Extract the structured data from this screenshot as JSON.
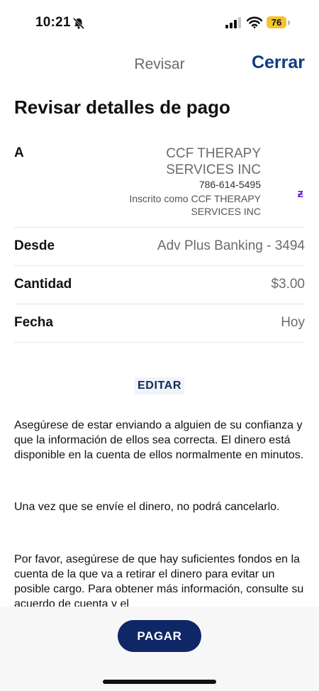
{
  "status": {
    "time": "10:21",
    "battery": "76"
  },
  "nav": {
    "title": "Revisar",
    "close_label": "Cerrar"
  },
  "page_title": "Revisar detalles de pago",
  "recipient": {
    "label": "A",
    "name": "CCF THERAPY SERVICES INC",
    "phone": "786-614-5495",
    "enrolled": "Inscrito como CCF THERAPY SERVICES INC",
    "service_icon": "ƶ"
  },
  "details": [
    {
      "label": "Desde",
      "value": "Adv Plus Banking - 3494"
    },
    {
      "label": "Cantidad",
      "value": "$3.00"
    },
    {
      "label": "Fecha",
      "value": "Hoy"
    }
  ],
  "edit_label": "EDITAR",
  "paragraphs": [
    "Asegúrese de estar enviando a alguien de su confianza y que la información de ellos sea correcta. El dinero está disponible en la cuenta de ellos normalmente en minutos.",
    "Una vez que se envíe el dinero, no podrá cancelarlo.",
    "Por favor, asegúrese de que hay suficientes fondos en la cuenta de la que va a retirar el dinero para evitar un posible cargo. Para obtener más información, consulte su acuerdo de cuenta y el"
  ],
  "pay_label": "PAGAR",
  "colors": {
    "accent": "#0f3c84",
    "pay_button": "#0f2766",
    "zelle": "#6d1ed4",
    "battery": "#f4c430"
  }
}
